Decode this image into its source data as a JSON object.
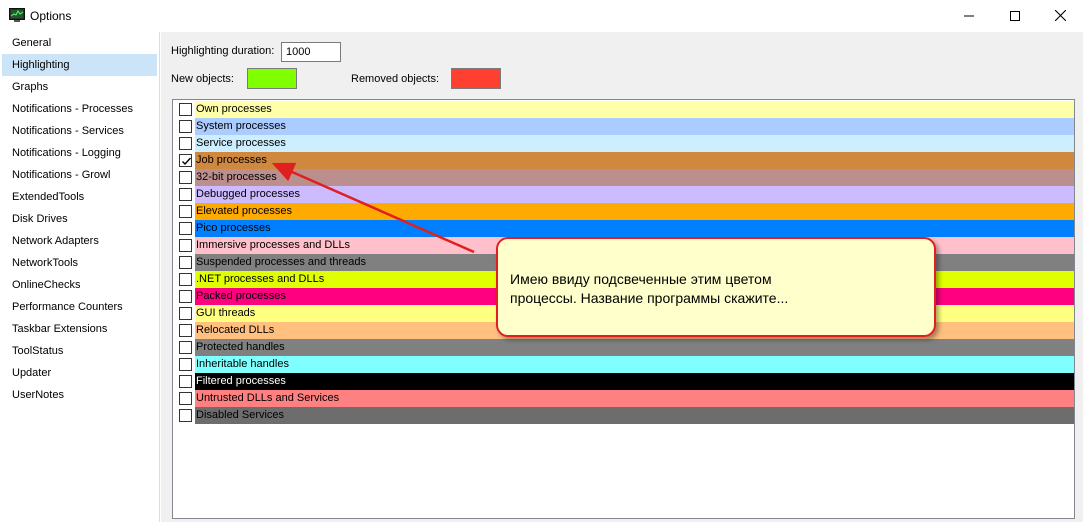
{
  "window": {
    "title": "Options"
  },
  "sidebar": {
    "items": [
      {
        "label": "General",
        "selected": false
      },
      {
        "label": "Highlighting",
        "selected": true
      },
      {
        "label": "Graphs",
        "selected": false
      },
      {
        "label": "Notifications - Processes",
        "selected": false
      },
      {
        "label": "Notifications - Services",
        "selected": false
      },
      {
        "label": "Notifications - Logging",
        "selected": false
      },
      {
        "label": "Notifications - Growl",
        "selected": false
      },
      {
        "label": "ExtendedTools",
        "selected": false
      },
      {
        "label": "Disk Drives",
        "selected": false
      },
      {
        "label": "Network Adapters",
        "selected": false
      },
      {
        "label": "NetworkTools",
        "selected": false
      },
      {
        "label": "OnlineChecks",
        "selected": false
      },
      {
        "label": "Performance Counters",
        "selected": false
      },
      {
        "label": "Taskbar Extensions",
        "selected": false
      },
      {
        "label": "ToolStatus",
        "selected": false
      },
      {
        "label": "Updater",
        "selected": false
      },
      {
        "label": "UserNotes",
        "selected": false
      }
    ]
  },
  "highlighting": {
    "duration_label": "Highlighting duration:",
    "duration_value": "1000",
    "new_objects_label": "New objects:",
    "new_objects_color": "#80ff00",
    "removed_objects_label": "Removed objects:",
    "removed_objects_color": "#ff3f2f",
    "items": [
      {
        "label": "Own processes",
        "color": "#ffffaa",
        "checked": false,
        "text_color": "#000000"
      },
      {
        "label": "System processes",
        "color": "#aaccff",
        "checked": false,
        "text_color": "#000000"
      },
      {
        "label": "Service processes",
        "color": "#cceeff",
        "checked": false,
        "text_color": "#000000"
      },
      {
        "label": "Job processes",
        "color": "#d0883f",
        "checked": true,
        "text_color": "#000000"
      },
      {
        "label": "32-bit processes",
        "color": "#bc8f8f",
        "checked": false,
        "text_color": "#000000"
      },
      {
        "label": "Debugged processes",
        "color": "#ccbbff",
        "checked": false,
        "text_color": "#000000"
      },
      {
        "label": "Elevated processes",
        "color": "#ffaa00",
        "checked": false,
        "text_color": "#000000"
      },
      {
        "label": "Pico processes",
        "color": "#0080ff",
        "checked": false,
        "text_color": "#000000"
      },
      {
        "label": "Immersive processes and DLLs",
        "color": "#ffc0cb",
        "checked": false,
        "text_color": "#000000"
      },
      {
        "label": "Suspended processes and threads",
        "color": "#808080",
        "checked": false,
        "text_color": "#000000"
      },
      {
        "label": ".NET processes and DLLs",
        "color": "#e0ff00",
        "checked": false,
        "text_color": "#000000"
      },
      {
        "label": "Packed processes",
        "color": "#ff0080",
        "checked": false,
        "text_color": "#000000"
      },
      {
        "label": "GUI threads",
        "color": "#ffff80",
        "checked": false,
        "text_color": "#000000"
      },
      {
        "label": "Relocated DLLs",
        "color": "#ffc080",
        "checked": false,
        "text_color": "#000000"
      },
      {
        "label": "Protected handles",
        "color": "#808080",
        "checked": false,
        "text_color": "#000000"
      },
      {
        "label": "Inheritable handles",
        "color": "#80ffff",
        "checked": false,
        "text_color": "#000000"
      },
      {
        "label": "Filtered processes",
        "color": "#000000",
        "checked": false,
        "text_color": "#ffffff"
      },
      {
        "label": "Untrusted DLLs and Services",
        "color": "#ff8080",
        "checked": false,
        "text_color": "#000000"
      },
      {
        "label": "Disabled Services",
        "color": "#6d6d6d",
        "checked": false,
        "text_color": "#000000"
      }
    ]
  },
  "callout": {
    "line1": "Имею ввиду подсвеченные этим цветом",
    "line2": "процессы. Название программы скажите..."
  }
}
